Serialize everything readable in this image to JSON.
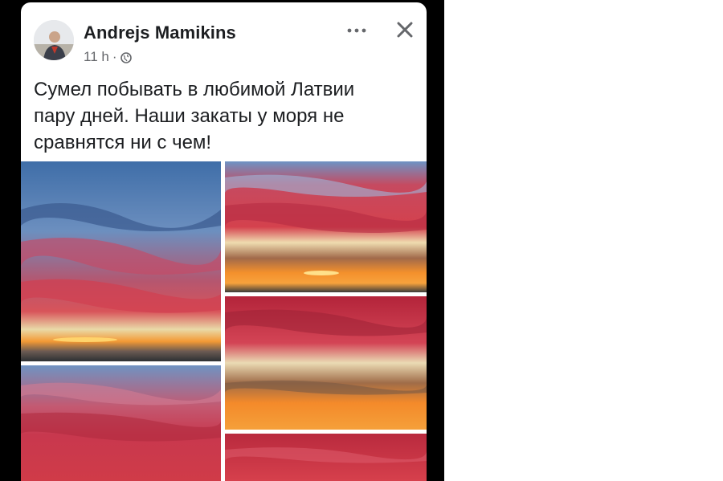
{
  "post": {
    "author_name": "Andrejs Mamikins",
    "time": "11 h",
    "separator": "·",
    "privacy_icon": "globe-icon",
    "more_icon": "more-horizontal-icon",
    "close_icon": "close-icon",
    "text_lines": [
      "Сумел побывать в любимой Латвии",
      "пару дней. Наши закаты у моря не",
      "сравнятся ни с чем!"
    ],
    "photos_count": 5
  },
  "colors": {
    "frame": "#000000",
    "card": "#ffffff",
    "name": "#1c1e21",
    "meta": "#65676b",
    "sky_blue": "#5e86b8",
    "cloud_red": "#c8384e",
    "sunset_orange": "#f08a2a"
  }
}
